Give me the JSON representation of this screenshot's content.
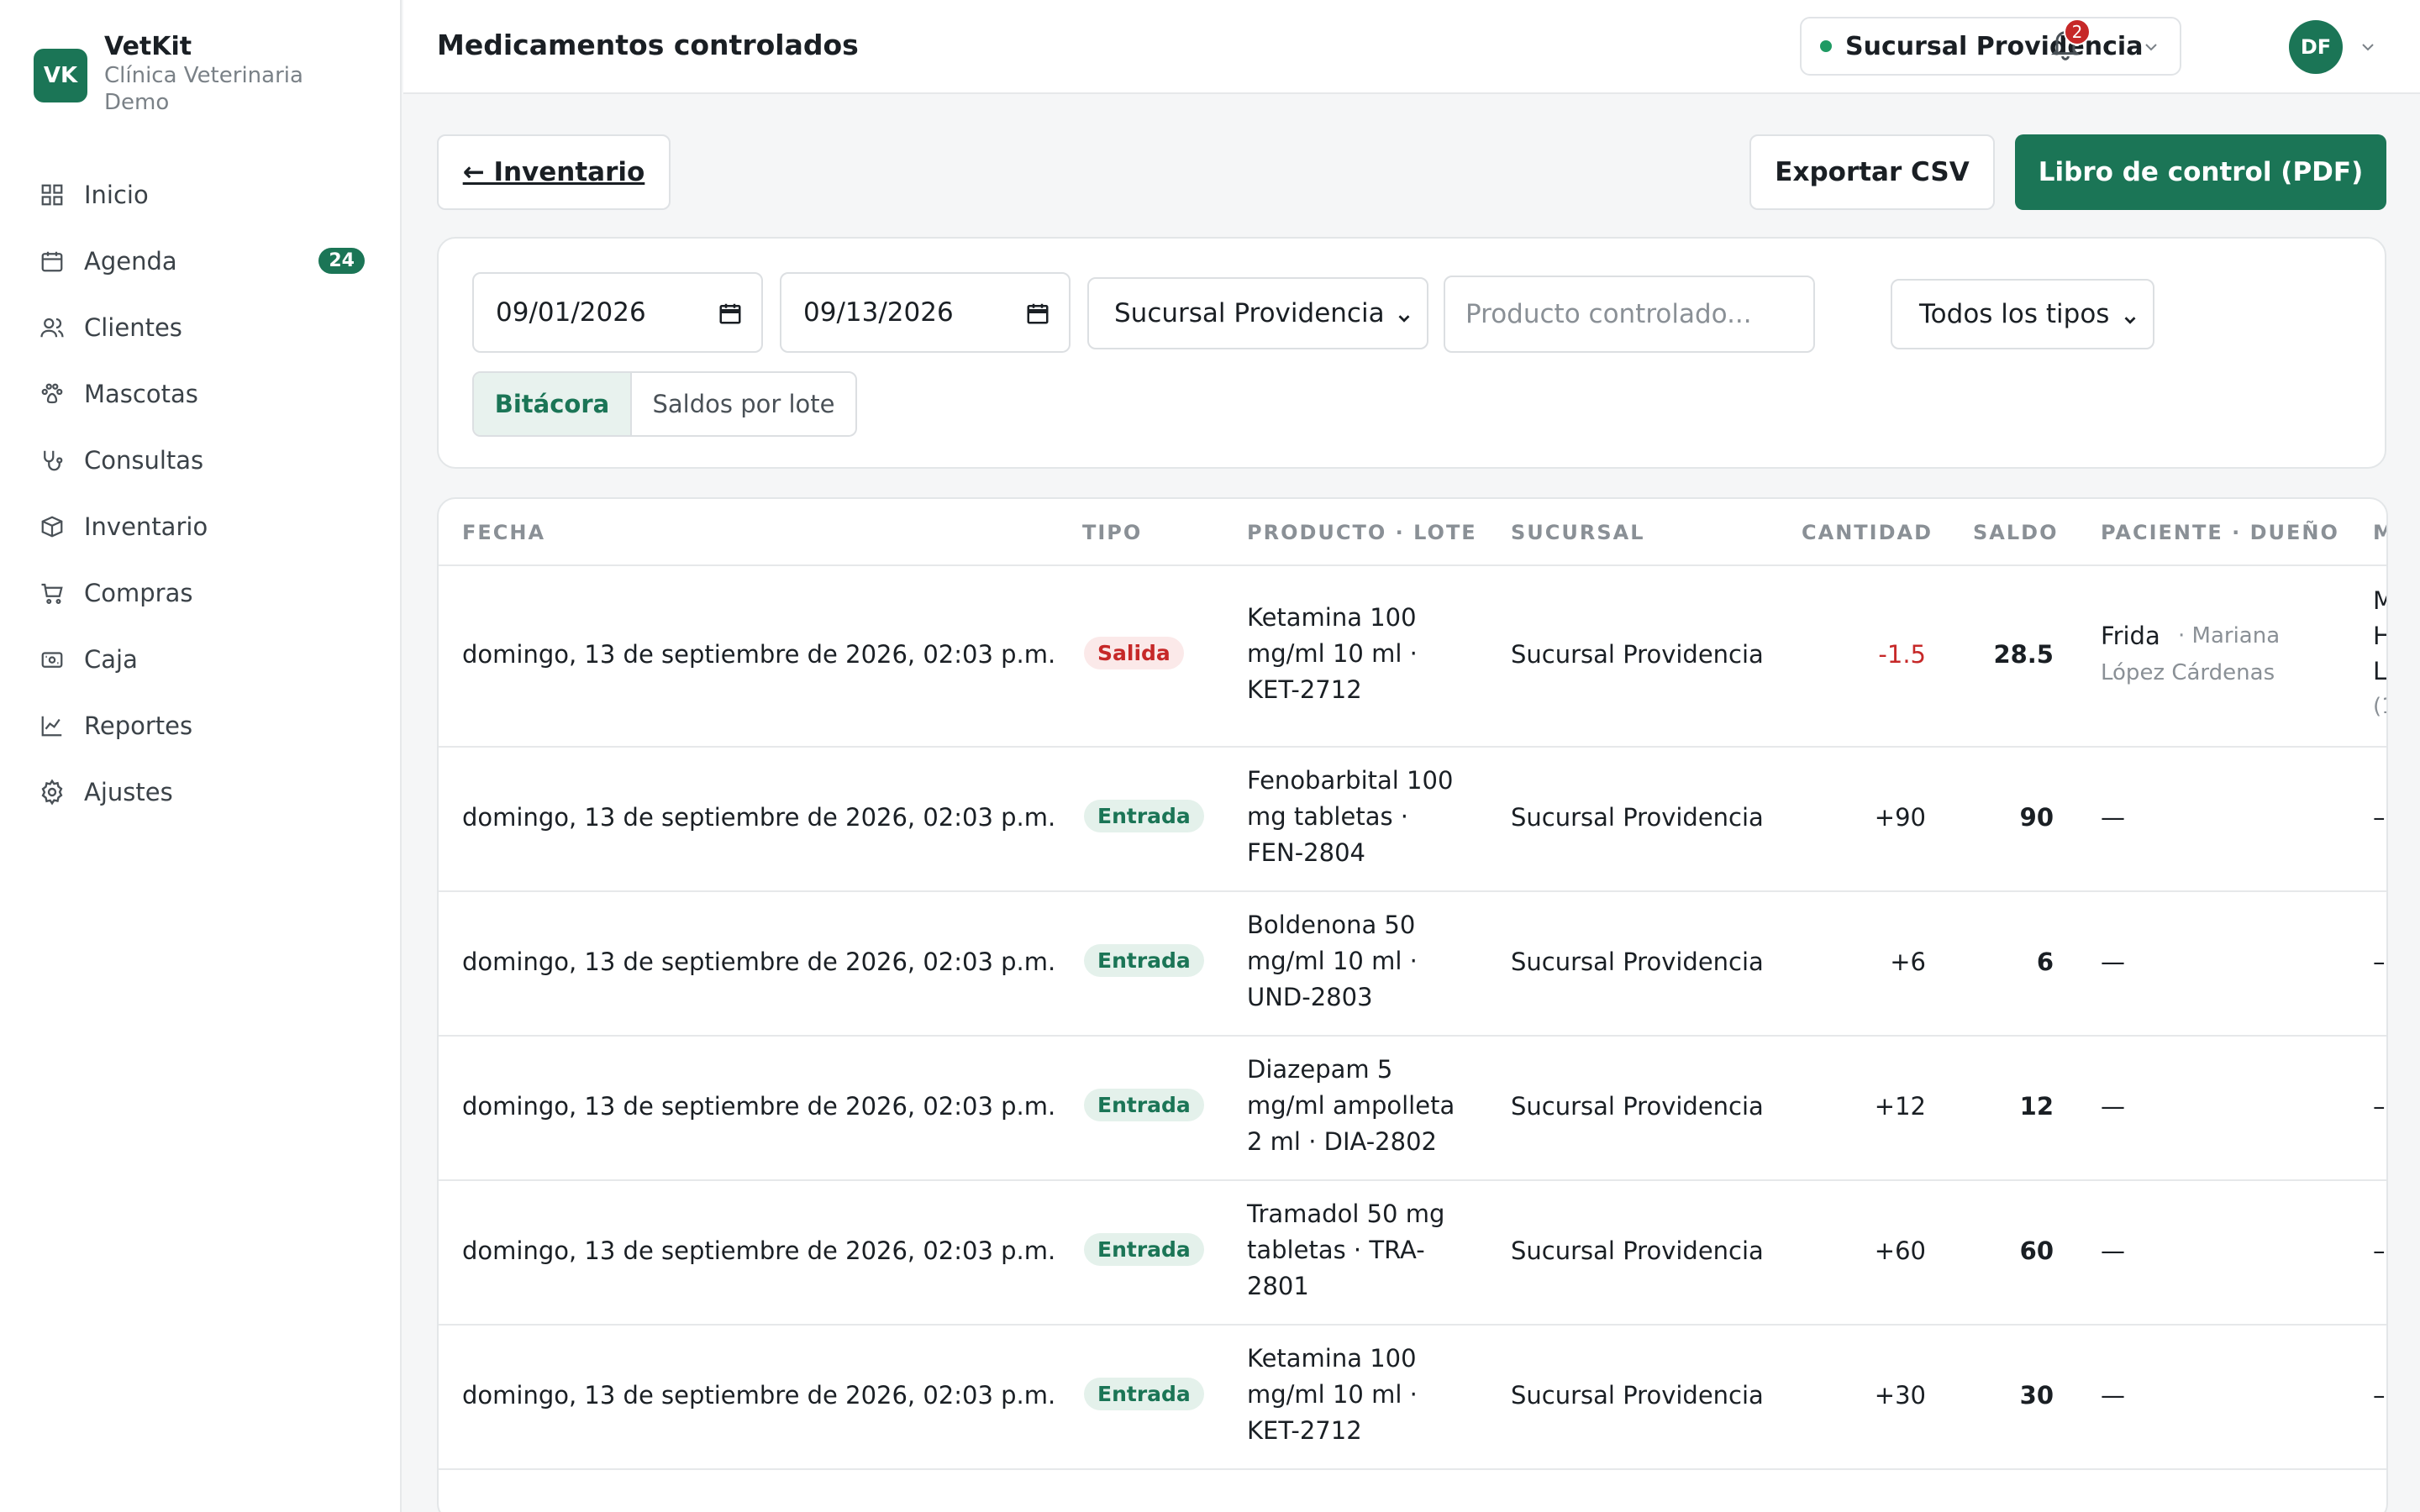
{
  "app": {
    "logo": "VK",
    "name": "VetKit",
    "subtitle": "Clínica Veterinaria Demo"
  },
  "sidebar": {
    "items": [
      {
        "label": "Inicio",
        "icon": "grid-icon"
      },
      {
        "label": "Agenda",
        "icon": "calendar-icon",
        "badge": "24"
      },
      {
        "label": "Clientes",
        "icon": "users-icon"
      },
      {
        "label": "Mascotas",
        "icon": "paw-icon"
      },
      {
        "label": "Consultas",
        "icon": "stethoscope-icon"
      },
      {
        "label": "Inventario",
        "icon": "box-icon"
      },
      {
        "label": "Compras",
        "icon": "cart-icon"
      },
      {
        "label": "Caja",
        "icon": "cash-icon"
      },
      {
        "label": "Reportes",
        "icon": "chart-icon"
      },
      {
        "label": "Ajustes",
        "icon": "gear-icon"
      }
    ]
  },
  "header": {
    "title": "Medicamentos controlados",
    "branch": "Sucursal Providencia",
    "notifications": "2",
    "avatar": "DF"
  },
  "actions": {
    "back": "← Inventario",
    "export": "Exportar CSV",
    "pdf": "Libro de control (PDF)"
  },
  "filters": {
    "date_from": "09/01/2026",
    "date_to": "09/13/2026",
    "branch": "Sucursal Providencia",
    "product_placeholder": "Producto controlado...",
    "type": "Todos los tipos",
    "view_tabs": [
      "Bitácora",
      "Saldos por lote"
    ],
    "active_tab": "Bitácora"
  },
  "table": {
    "columns": [
      "FECHA",
      "TIPO",
      "PRODUCTO · LOTE",
      "SUCURSAL",
      "CANTIDAD",
      "SALDO",
      "PACIENTE · DUEÑO",
      "M"
    ],
    "rows": [
      {
        "fecha": "domingo, 13 de septiembre de 2026, 02:03 p.m.",
        "tipo": "Salida",
        "producto": [
          "Ketamina 100",
          "mg/ml 10 ml ·",
          "KET-2712"
        ],
        "sucursal": "Sucursal Providencia",
        "cantidad": "-1.5",
        "saldo": "28.5",
        "paciente": "Frida",
        "dueno": [
          "· Mariana",
          "López Cárdenas"
        ],
        "extra": [
          "M",
          "H",
          "L",
          "(1"
        ]
      },
      {
        "fecha": "domingo, 13 de septiembre de 2026, 02:03 p.m.",
        "tipo": "Entrada",
        "producto": [
          "Fenobarbital 100",
          "mg tabletas ·",
          "FEN-2804"
        ],
        "sucursal": "Sucursal Providencia",
        "cantidad": "+90",
        "saldo": "90",
        "paciente": "—",
        "dueno": [],
        "extra": [
          "–"
        ]
      },
      {
        "fecha": "domingo, 13 de septiembre de 2026, 02:03 p.m.",
        "tipo": "Entrada",
        "producto": [
          "Boldenona 50",
          "mg/ml 10 ml ·",
          "UND-2803"
        ],
        "sucursal": "Sucursal Providencia",
        "cantidad": "+6",
        "saldo": "6",
        "paciente": "—",
        "dueno": [],
        "extra": [
          "–"
        ]
      },
      {
        "fecha": "domingo, 13 de septiembre de 2026, 02:03 p.m.",
        "tipo": "Entrada",
        "producto": [
          "Diazepam 5",
          "mg/ml ampolleta",
          "2 ml · DIA-2802"
        ],
        "sucursal": "Sucursal Providencia",
        "cantidad": "+12",
        "saldo": "12",
        "paciente": "—",
        "dueno": [],
        "extra": [
          "–"
        ]
      },
      {
        "fecha": "domingo, 13 de septiembre de 2026, 02:03 p.m.",
        "tipo": "Entrada",
        "producto": [
          "Tramadol 50 mg",
          "tabletas · TRA-",
          "2801"
        ],
        "sucursal": "Sucursal Providencia",
        "cantidad": "+60",
        "saldo": "60",
        "paciente": "—",
        "dueno": [],
        "extra": [
          "–"
        ]
      },
      {
        "fecha": "domingo, 13 de septiembre de 2026, 02:03 p.m.",
        "tipo": "Entrada",
        "producto": [
          "Ketamina 100",
          "mg/ml 10 ml ·",
          "KET-2712"
        ],
        "sucursal": "Sucursal Providencia",
        "cantidad": "+30",
        "saldo": "30",
        "paciente": "—",
        "dueno": [],
        "extra": [
          "–"
        ]
      }
    ]
  },
  "colors": {
    "brand": "#1b7556",
    "danger": "#c62828",
    "positive_dot": "#1f9a63"
  }
}
